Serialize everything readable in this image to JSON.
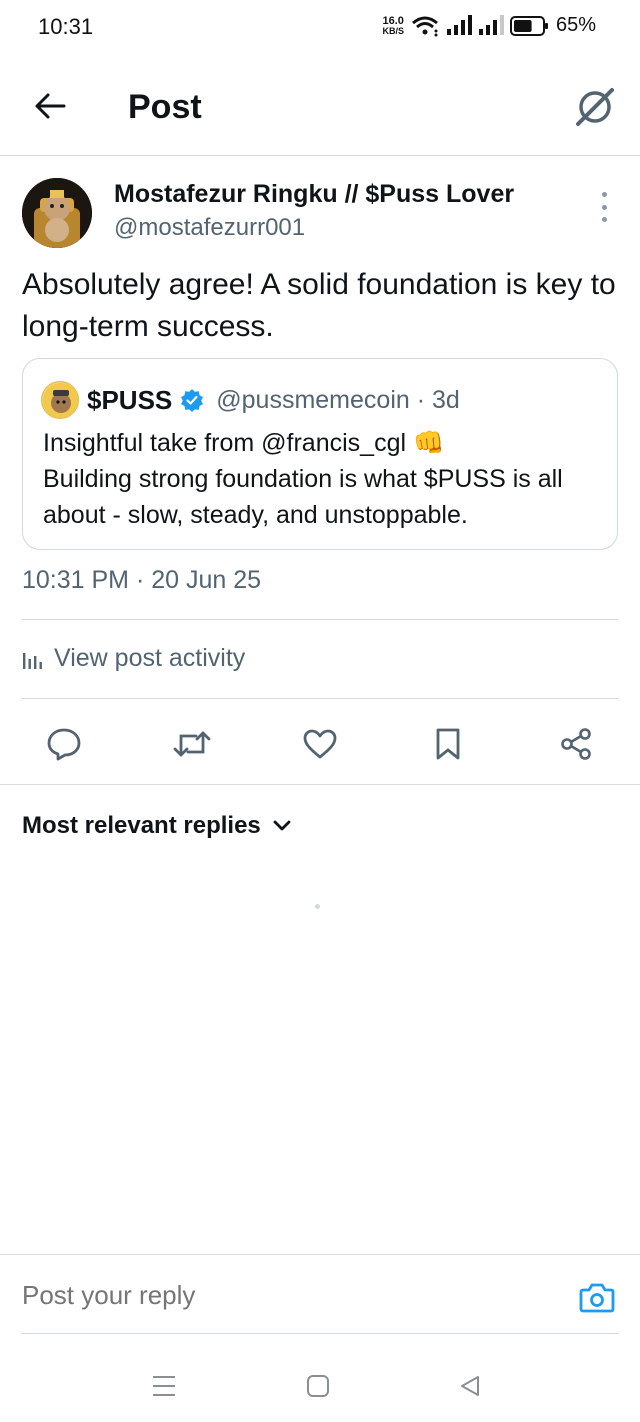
{
  "status_bar": {
    "time": "10:31",
    "net_speed": "16.0",
    "net_unit": "KB/S",
    "battery": "65%",
    "battery_level": 0.65
  },
  "header": {
    "title": "Post",
    "back_icon": "arrow-left-icon",
    "grok_icon": "grok-icon"
  },
  "post": {
    "author_name": "Mostafezur Ringku // $Puss Lover",
    "author_handle": "@mostafezurr001",
    "text": "Absolutely agree! A solid foundation is key to long-term success.",
    "timestamp": "10:31 PM · 20 Jun 25",
    "quote": {
      "name": "$PUSS",
      "handle_time": "@pussmemecoin · 3d",
      "line1": "Insightful take from @francis_cgl 👊",
      "line2": "Building strong foundation is what $PUSS is all about - slow, steady, and unstoppable."
    }
  },
  "activity_label": "View post activity",
  "actions": [
    "reply-icon",
    "repost-icon",
    "like-icon",
    "bookmark-icon",
    "share-icon"
  ],
  "replies_sort_label": "Most relevant replies",
  "reply_bar": {
    "placeholder": "Post your reply"
  },
  "colors": {
    "accent": "#1d9bf0",
    "secondary_text": "#536471",
    "divider": "#d9dde0"
  }
}
